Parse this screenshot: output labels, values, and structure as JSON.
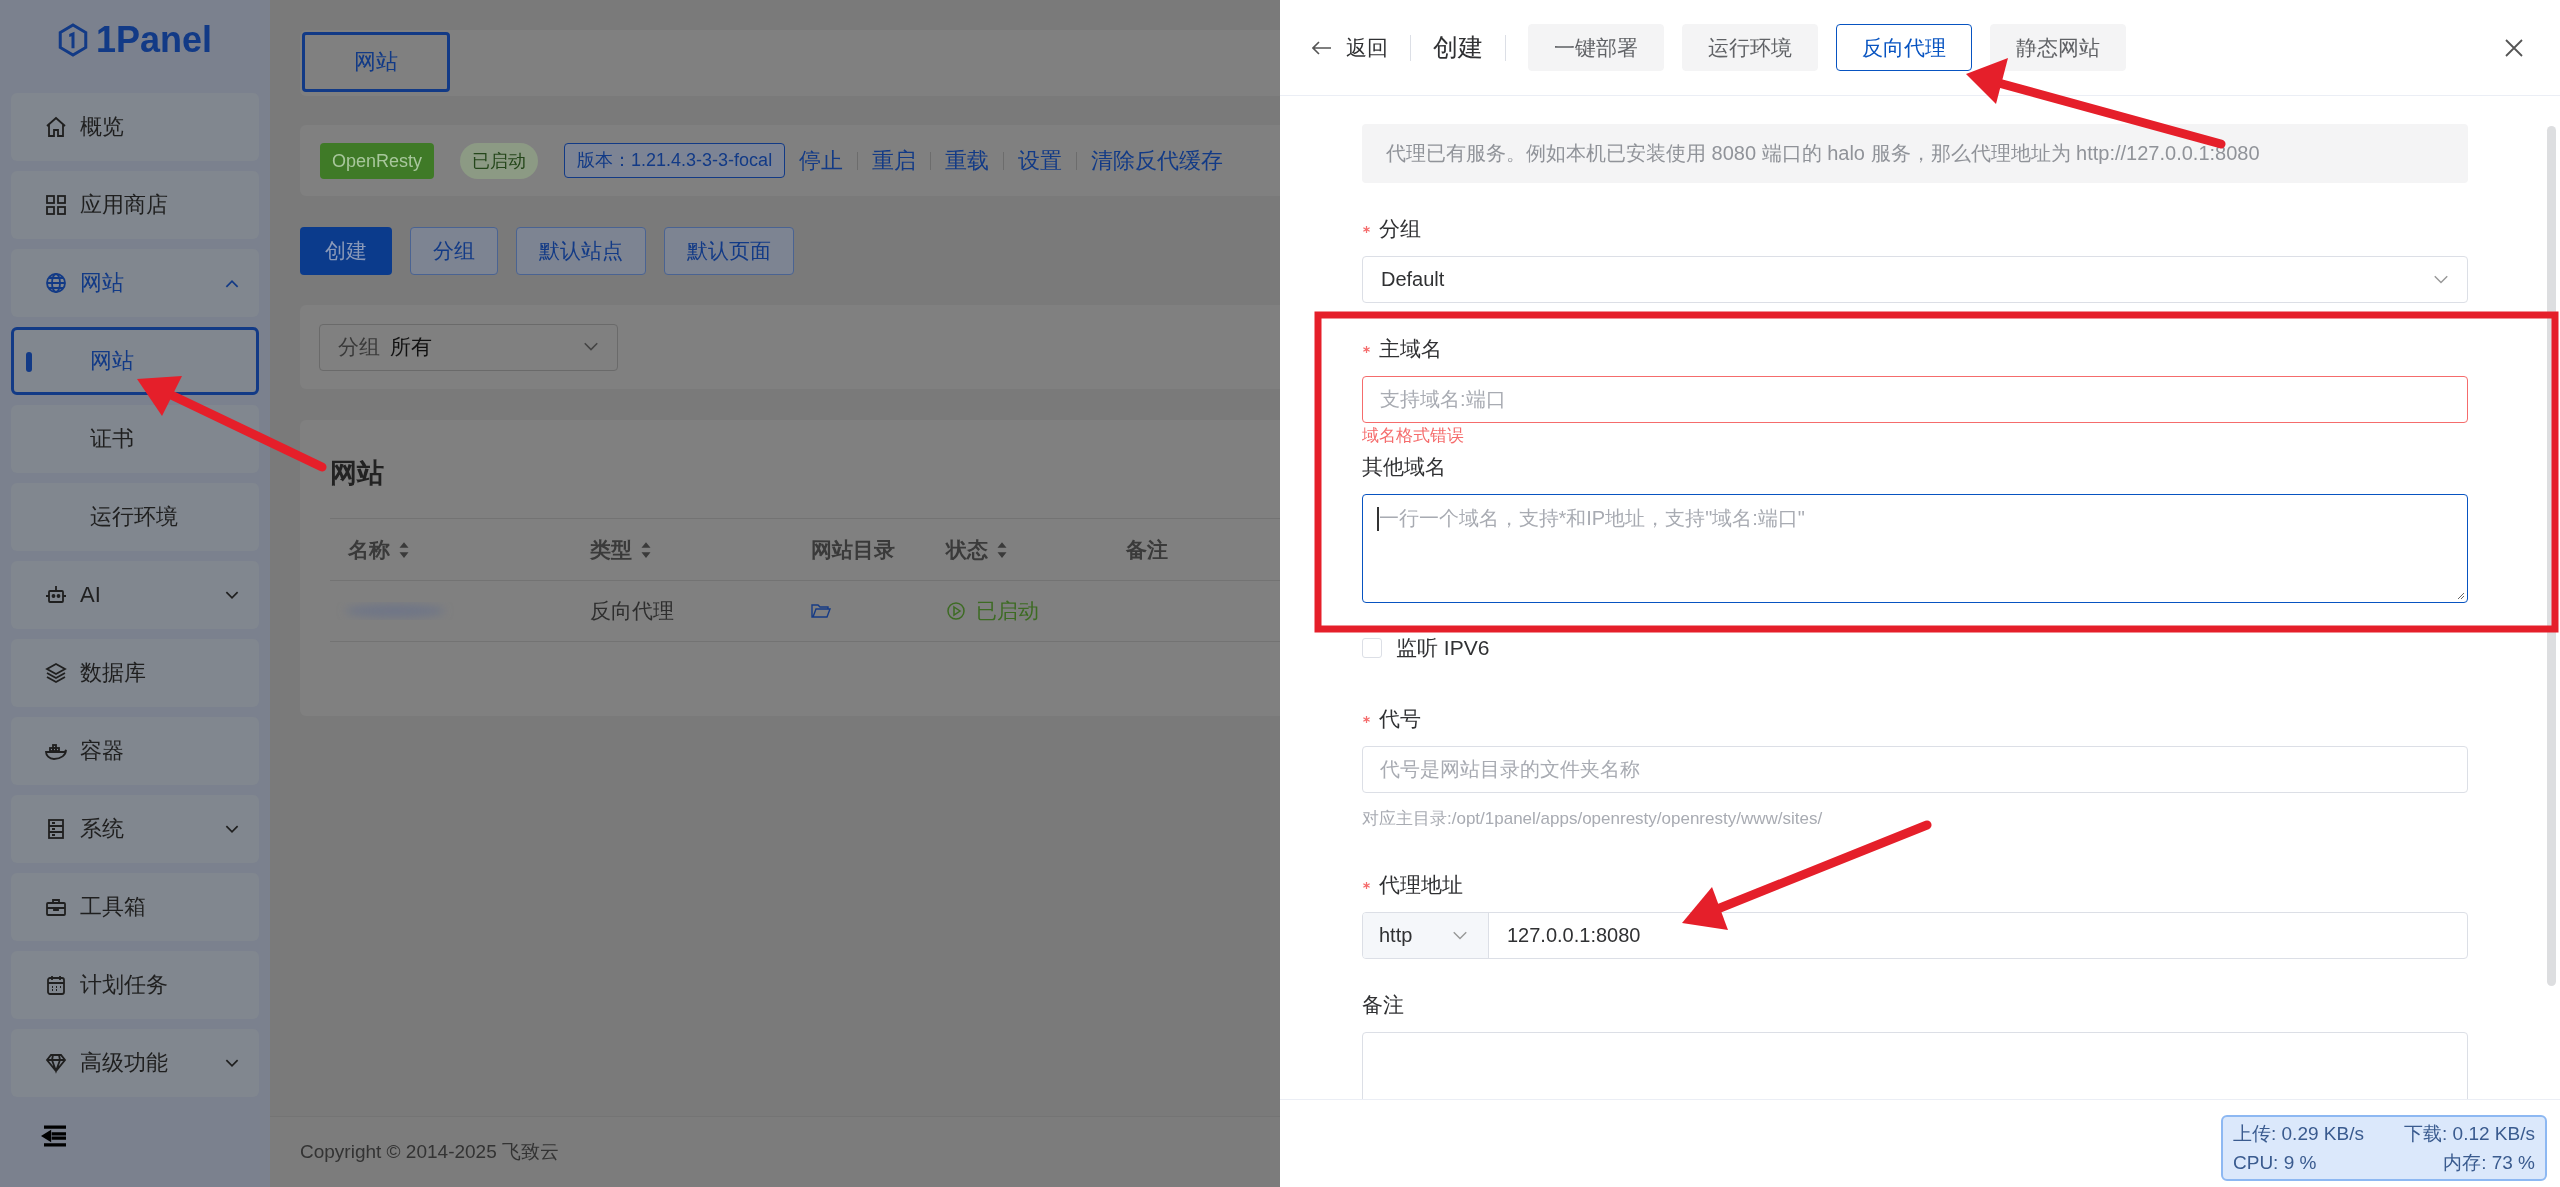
{
  "sidebar": {
    "logo": "1Panel",
    "items": [
      {
        "label": "概览",
        "kind": "link",
        "selected": false
      },
      {
        "label": "应用商店",
        "kind": "link",
        "selected": false
      },
      {
        "label": "网站",
        "kind": "group",
        "selected": true,
        "expanded": true,
        "children": [
          {
            "label": "网站",
            "selected": true
          },
          {
            "label": "证书",
            "selected": false
          },
          {
            "label": "运行环境",
            "selected": false
          }
        ]
      },
      {
        "label": "AI",
        "kind": "group",
        "selected": false,
        "expanded": false
      },
      {
        "label": "数据库",
        "kind": "link",
        "selected": false
      },
      {
        "label": "容器",
        "kind": "link",
        "selected": false
      },
      {
        "label": "系统",
        "kind": "group",
        "selected": false,
        "expanded": false
      },
      {
        "label": "工具箱",
        "kind": "link",
        "selected": false
      },
      {
        "label": "计划任务",
        "kind": "link",
        "selected": false
      },
      {
        "label": "高级功能",
        "kind": "group",
        "selected": false,
        "expanded": false
      }
    ]
  },
  "main": {
    "page_tabs": [
      {
        "label": "网站",
        "selected": true
      }
    ],
    "server_bar": {
      "app_tag": "OpenResty",
      "status_tag": "已启动",
      "version_tag": "版本：1.21.4.3-3-3-focal",
      "actions": [
        "停止",
        "重启",
        "重载",
        "设置",
        "清除反代缓存"
      ]
    },
    "toolbar": [
      {
        "label": "创建",
        "kind": "primary"
      },
      {
        "label": "分组",
        "kind": "default"
      },
      {
        "label": "默认站点",
        "kind": "default"
      },
      {
        "label": "默认页面",
        "kind": "default"
      }
    ],
    "filter": {
      "label": "分组",
      "value": "所有"
    },
    "sites": {
      "title": "网站",
      "columns": [
        {
          "label": "名称",
          "sortable": true
        },
        {
          "label": "类型",
          "sortable": true
        },
        {
          "label": "网站目录",
          "sortable": false
        },
        {
          "label": "状态",
          "sortable": true
        },
        {
          "label": "备注",
          "sortable": false
        }
      ],
      "rows": [
        {
          "type": "反向代理",
          "status": "已启动",
          "running": true
        }
      ]
    },
    "footer": "Copyright © 2014-2025 飞致云"
  },
  "drawer": {
    "back": "返回",
    "title": "创建",
    "tabs": [
      {
        "label": "一键部署",
        "selected": false
      },
      {
        "label": "运行环境",
        "selected": false
      },
      {
        "label": "反向代理",
        "selected": true
      },
      {
        "label": "静态网站",
        "selected": false
      }
    ],
    "alert": "代理已有服务。例如本机已安装使用 8080 端口的 halo 服务，那么代理地址为 http://127.0.0.1:8080",
    "fields": [
      {
        "kind": "select",
        "label": "分组",
        "required": true,
        "value": "Default"
      },
      {
        "kind": "input",
        "label": "主域名",
        "required": true,
        "placeholder": "支持域名:端口",
        "error": "域名格式错误",
        "focused": false
      },
      {
        "kind": "textarea",
        "label": "其他域名",
        "required": false,
        "placeholder": "一行一个域名，支持*和IP地址，支持\"域名:端口\"",
        "focused": true
      },
      {
        "kind": "checkbox",
        "label": "监听 IPV6",
        "checked": false
      },
      {
        "kind": "input",
        "label": "代号",
        "required": true,
        "placeholder": "代号是网站目录的文件夹名称",
        "hint": "对应主目录:/opt/1panel/apps/openresty/openresty/www/sites/",
        "focused": false
      },
      {
        "kind": "input_group",
        "label": "代理地址",
        "required": true,
        "prefix": "http",
        "value": "127.0.0.1:8080"
      },
      {
        "kind": "textarea",
        "label": "备注",
        "required": false,
        "focused": false
      }
    ]
  },
  "net_monitor": {
    "upload": "上传: 0.29 KB/s",
    "download": "下载: 0.12 KB/s",
    "cpu": "CPU: 9 %",
    "memory": "内存: 73 %"
  }
}
